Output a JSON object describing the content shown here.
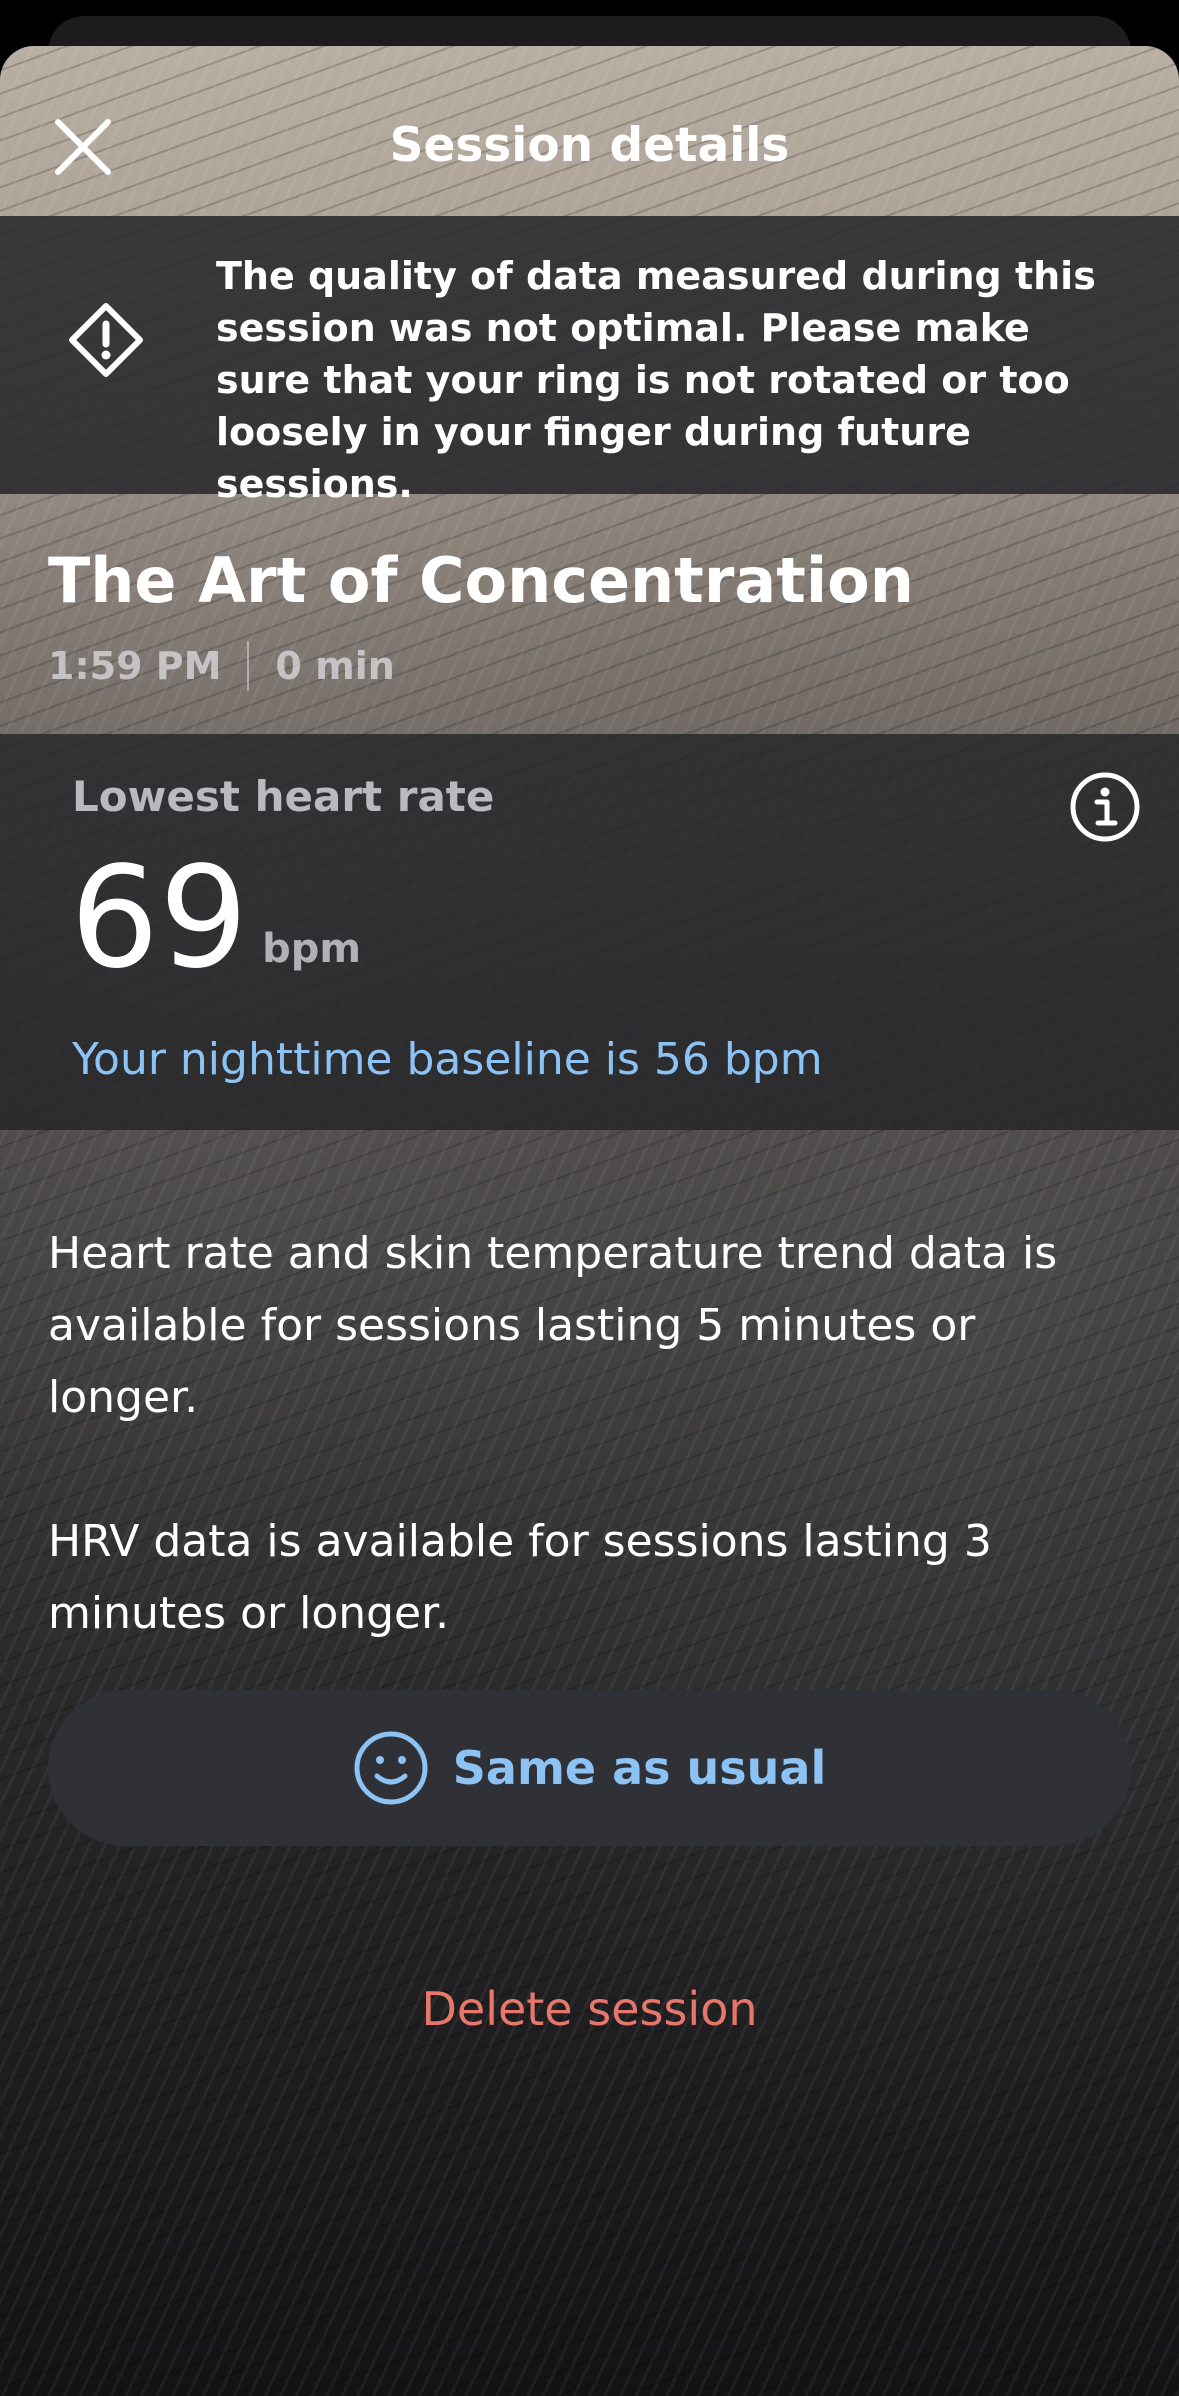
{
  "header": {
    "title": "Session details",
    "close_icon": "close-icon"
  },
  "warning": {
    "icon": "warning-diamond-icon",
    "message": "The quality of data measured during this session was not optimal. Please make sure that your ring is not rotated or too loosely in your finger during future sessions."
  },
  "session": {
    "name": "The Art of Concentration",
    "time": "1:59 PM",
    "duration": "0 min"
  },
  "heart_rate": {
    "label": "Lowest heart rate",
    "value": "69",
    "unit": "bpm",
    "baseline_text": "Your nighttime baseline is 56 bpm",
    "info_icon": "info-icon"
  },
  "notes": {
    "trend_note": "Heart rate and skin temperature trend data is available for sessions lasting 5 minutes or longer.",
    "hrv_note": "HRV data is available for sessions lasting 3 minutes or longer."
  },
  "mood": {
    "icon": "smiley-face-icon",
    "label": "Same as usual"
  },
  "actions": {
    "delete_label": "Delete session"
  },
  "colors": {
    "accent_blue": "#8cc3f4",
    "danger_red": "#e8776b",
    "button_bg": "#2f3137"
  }
}
